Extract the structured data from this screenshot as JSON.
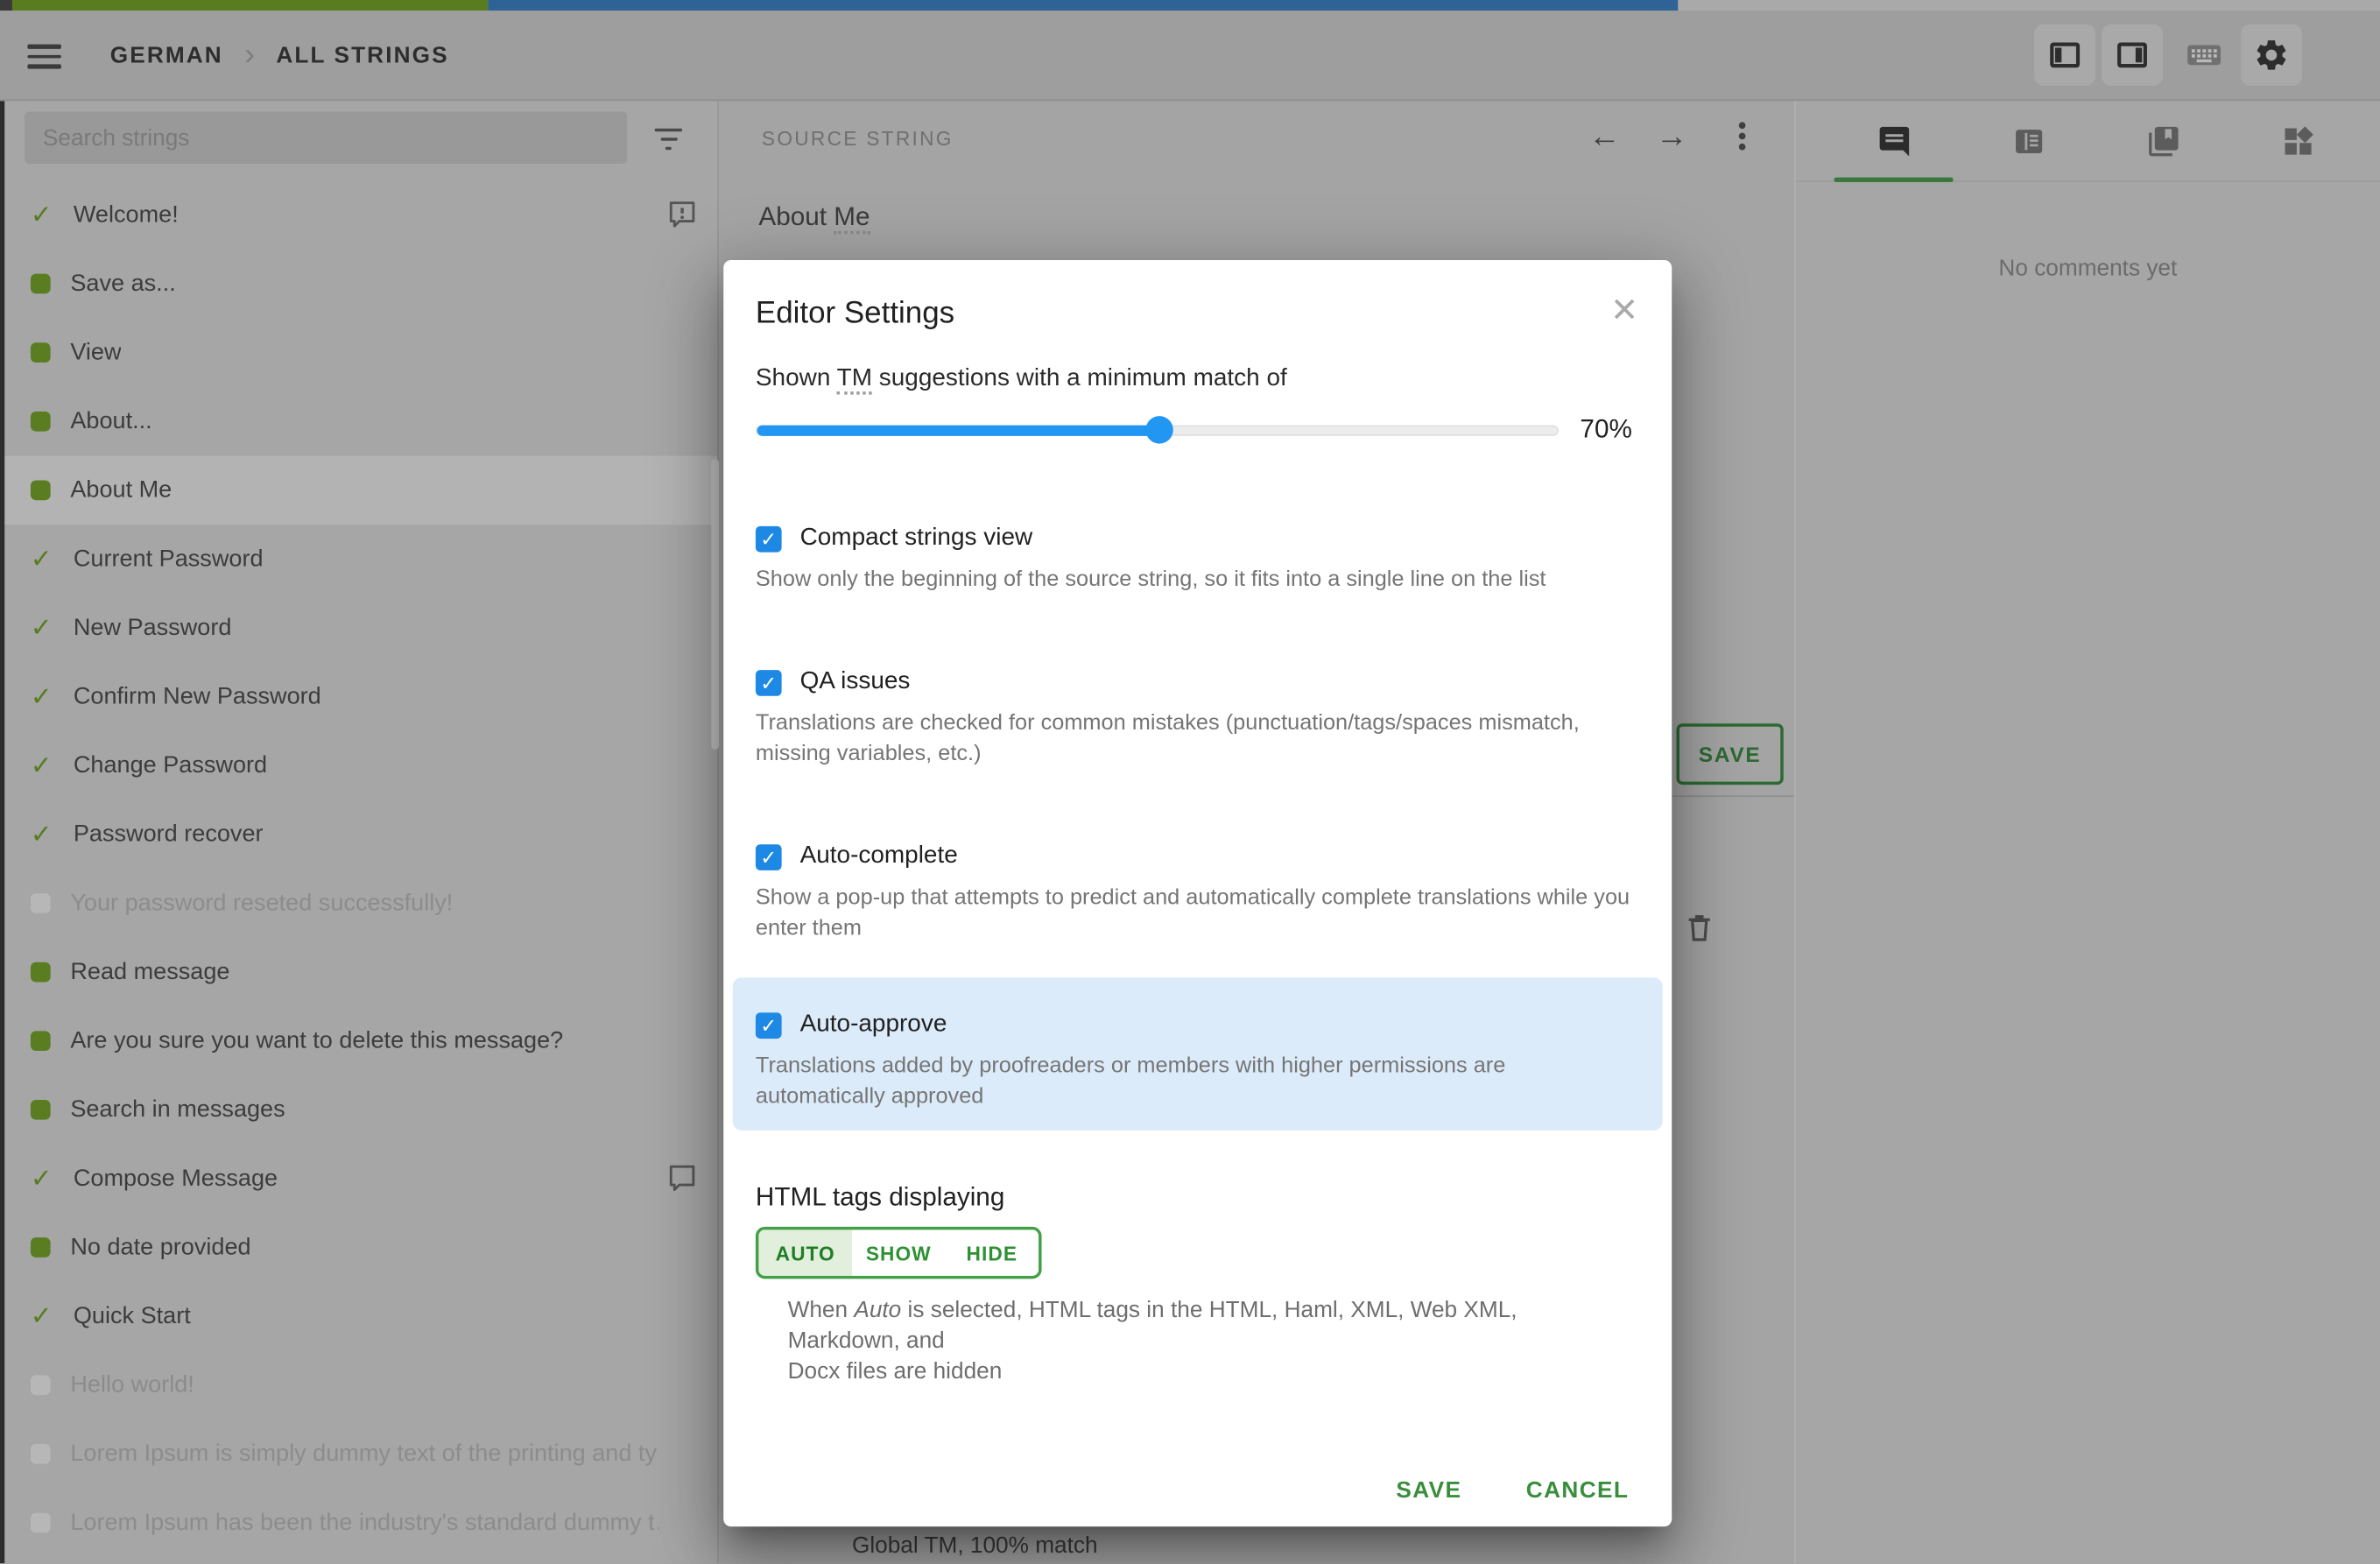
{
  "topbar": {
    "breadcrumb": {
      "project": "GERMAN",
      "section": "ALL STRINGS"
    },
    "icons": [
      "menu-icon",
      "layout-left-panel-icon",
      "layout-right-panel-icon",
      "keyboard-icon",
      "gear-icon",
      "avatar"
    ]
  },
  "progress": {
    "approved_pct": 20.5,
    "translated_pct": 50.0,
    "approved_color": "#597d1e",
    "translated_color": "#2f6396"
  },
  "sidebar": {
    "search_placeholder": "Search strings",
    "items": [
      {
        "label": "Welcome!",
        "status": "approved",
        "trailing": "issue"
      },
      {
        "label": "Save as...",
        "status": "translated"
      },
      {
        "label": "View",
        "status": "translated"
      },
      {
        "label": "About...",
        "status": "translated"
      },
      {
        "label": "About Me",
        "status": "translated",
        "selected": true
      },
      {
        "label": "Current Password",
        "status": "approved"
      },
      {
        "label": "New Password",
        "status": "approved"
      },
      {
        "label": "Confirm New Password",
        "status": "approved"
      },
      {
        "label": "Change Password",
        "status": "approved"
      },
      {
        "label": "Password recover",
        "status": "approved"
      },
      {
        "label": "Your password reseted successfully!",
        "status": "untranslated"
      },
      {
        "label": "Read message",
        "status": "translated"
      },
      {
        "label": "Are you sure you want to delete this message?",
        "status": "translated"
      },
      {
        "label": "Search in messages",
        "status": "translated"
      },
      {
        "label": "Compose Message",
        "status": "approved",
        "trailing": "comment"
      },
      {
        "label": "No date provided",
        "status": "translated"
      },
      {
        "label": "Quick Start",
        "status": "approved"
      },
      {
        "label": "Hello world!",
        "status": "untranslated"
      },
      {
        "label": "Lorem Ipsum is simply dummy text of the printing and ty…",
        "status": "untranslated"
      },
      {
        "label": "Lorem Ipsum has been the industry's standard dummy t…",
        "status": "untranslated"
      }
    ]
  },
  "editor": {
    "panel_title": "SOURCE STRING",
    "source_prefix": "About ",
    "source_term": "Me",
    "save_button": "SAVE",
    "tm_suggestion": "Global TM, 100% match"
  },
  "comments": {
    "empty": "No comments yet"
  },
  "modal": {
    "title": "Editor Settings",
    "tm_prefix": "Shown ",
    "tm_abbr": "TM",
    "tm_suffix": " suggestions with a minimum match of",
    "slider_value": "70%",
    "slider": {
      "value": 70,
      "fill_pct": 50
    },
    "options": [
      {
        "label": "Compact strings view",
        "checked": true,
        "desc": "Show only the beginning of the source string, so it fits into a single line on the list"
      },
      {
        "label": "QA issues",
        "checked": true,
        "desc": "Translations are checked for common mistakes (punctuation/tags/spaces mismatch,\nmissing variables, etc.)"
      },
      {
        "label": "Auto-complete",
        "checked": true,
        "desc": "Show a pop-up that attempts to predict and automatically complete translations while you\nenter them"
      },
      {
        "label": "Auto-approve",
        "checked": true,
        "highlighted": true,
        "desc": "Translations added by proofreaders or members with higher permissions are\nautomatically approved"
      }
    ],
    "html_tags": {
      "label": "HTML tags displaying",
      "options": [
        "AUTO",
        "SHOW",
        "HIDE"
      ],
      "selected": "AUTO",
      "desc_pre": "When ",
      "desc_italic": "Auto",
      "desc_post": " is selected, HTML tags in the HTML, Haml, XML, Web XML, Markdown, and\nDocx files are hidden"
    },
    "save": "SAVE",
    "cancel": "CANCEL"
  },
  "colors": {
    "accent_green": "#43a047",
    "accent_blue": "#2196f3",
    "highlight_blue": "#dcebfa",
    "modal_bg": "#ffffff"
  }
}
